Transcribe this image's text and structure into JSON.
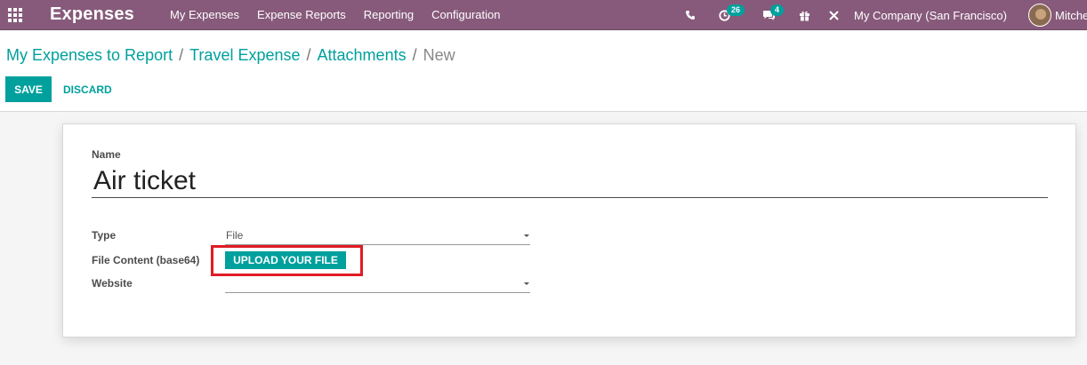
{
  "navbar": {
    "app_title": "Expenses",
    "menu": [
      {
        "label": "My Expenses"
      },
      {
        "label": "Expense Reports"
      },
      {
        "label": "Reporting"
      },
      {
        "label": "Configuration"
      }
    ],
    "systray": {
      "phone_icon": "phone-icon",
      "activity_icon": "clock-icon",
      "activity_count": "26",
      "messages_icon": "chat-icon",
      "messages_count": "4",
      "gift_icon": "gift-icon",
      "debug_icon": "tools-icon",
      "company": "My Company (San Francisco)",
      "user": "Mitchell Admin"
    },
    "colors": {
      "bar": "#875a7b",
      "accent": "#00a09d"
    }
  },
  "breadcrumb": {
    "items": [
      "My Expenses to Report",
      "Travel Expense",
      "Attachments"
    ],
    "current": "New"
  },
  "buttons": {
    "save": "SAVE",
    "discard": "DISCARD",
    "upload": "UPLOAD YOUR FILE"
  },
  "form": {
    "name_label": "Name",
    "name_value": "Air ticket",
    "type_label": "Type",
    "type_value": "File",
    "file_label": "File Content (base64)",
    "website_label": "Website",
    "website_value": ""
  }
}
